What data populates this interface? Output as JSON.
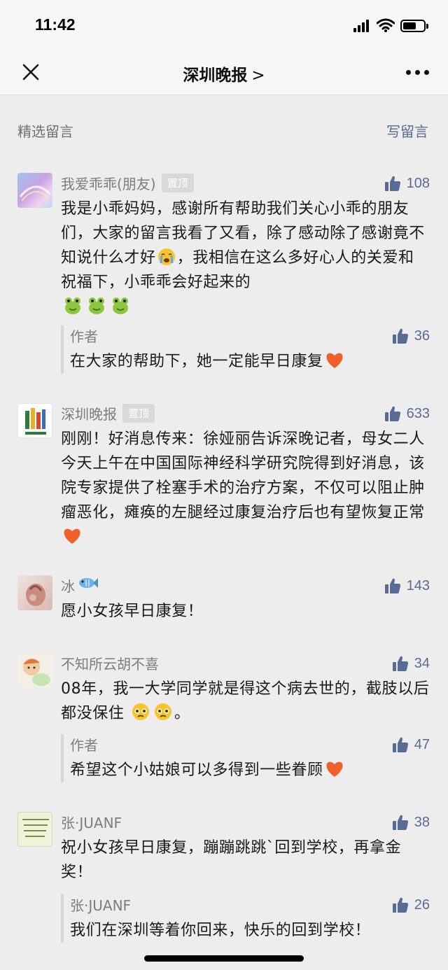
{
  "status": {
    "time": "11:42"
  },
  "nav": {
    "title": "深圳晚报",
    "chevron": ">"
  },
  "section": {
    "title": "精选留言",
    "write_label": "写留言"
  },
  "comments": [
    {
      "nick": "我爱乖乖(朋友)",
      "badge": "置顶",
      "likes": "108",
      "text": "我是小乖妈妈，感谢所有帮助我们关心小乖的朋友们，大家的留言我看了又看，除了感动除了感谢竟不知说什么才好",
      "text2": "，我相信在这么多好心人的关爱和祝福下，小乖乖会好起来的",
      "reply": {
        "nick": "作者",
        "likes": "36",
        "text": "在大家的帮助下，她一定能早日康复"
      }
    },
    {
      "nick": "深圳晚报",
      "badge": "置顶",
      "likes": "633",
      "text": "刚刚！好消息传来：徐娅丽告诉深晚记者，母女二人今天上午在中国国际神经科学研究院得到好消息，该院专家提供了栓塞手术的治疗方案，不仅可以阻止肿瘤恶化，瘫痪的左腿经过康复治疗后也有望恢复正常"
    },
    {
      "nick": "冰",
      "likes": "143",
      "text": "愿小女孩早日康复！"
    },
    {
      "nick": "不知所云胡不喜",
      "likes": "34",
      "text": "08年，我一大学同学就是得这个病去世的，截肢以后都没保住。",
      "text_end": "。",
      "reply": {
        "nick": "作者",
        "likes": "47",
        "text": "希望这个小姑娘可以多得到一些眷顾"
      }
    },
    {
      "nick": "张·JUANF",
      "likes": "38",
      "text": "祝小女孩早日康复，蹦蹦跳跳`回到学校，再拿金奖！",
      "reply": {
        "nick": "张·JUANF",
        "likes": "26",
        "text": "我们在深圳等着你回来，快乐的回到学校！"
      }
    }
  ],
  "colors": {
    "link": "#576b95",
    "background": "#ededed",
    "heart": "#f0602a"
  },
  "icons": [
    "close-icon",
    "more-icon",
    "thumbs-up-icon",
    "heart-icon",
    "crying-emoji",
    "frog-emoji",
    "fish-emoji",
    "pleading-emoji"
  ]
}
